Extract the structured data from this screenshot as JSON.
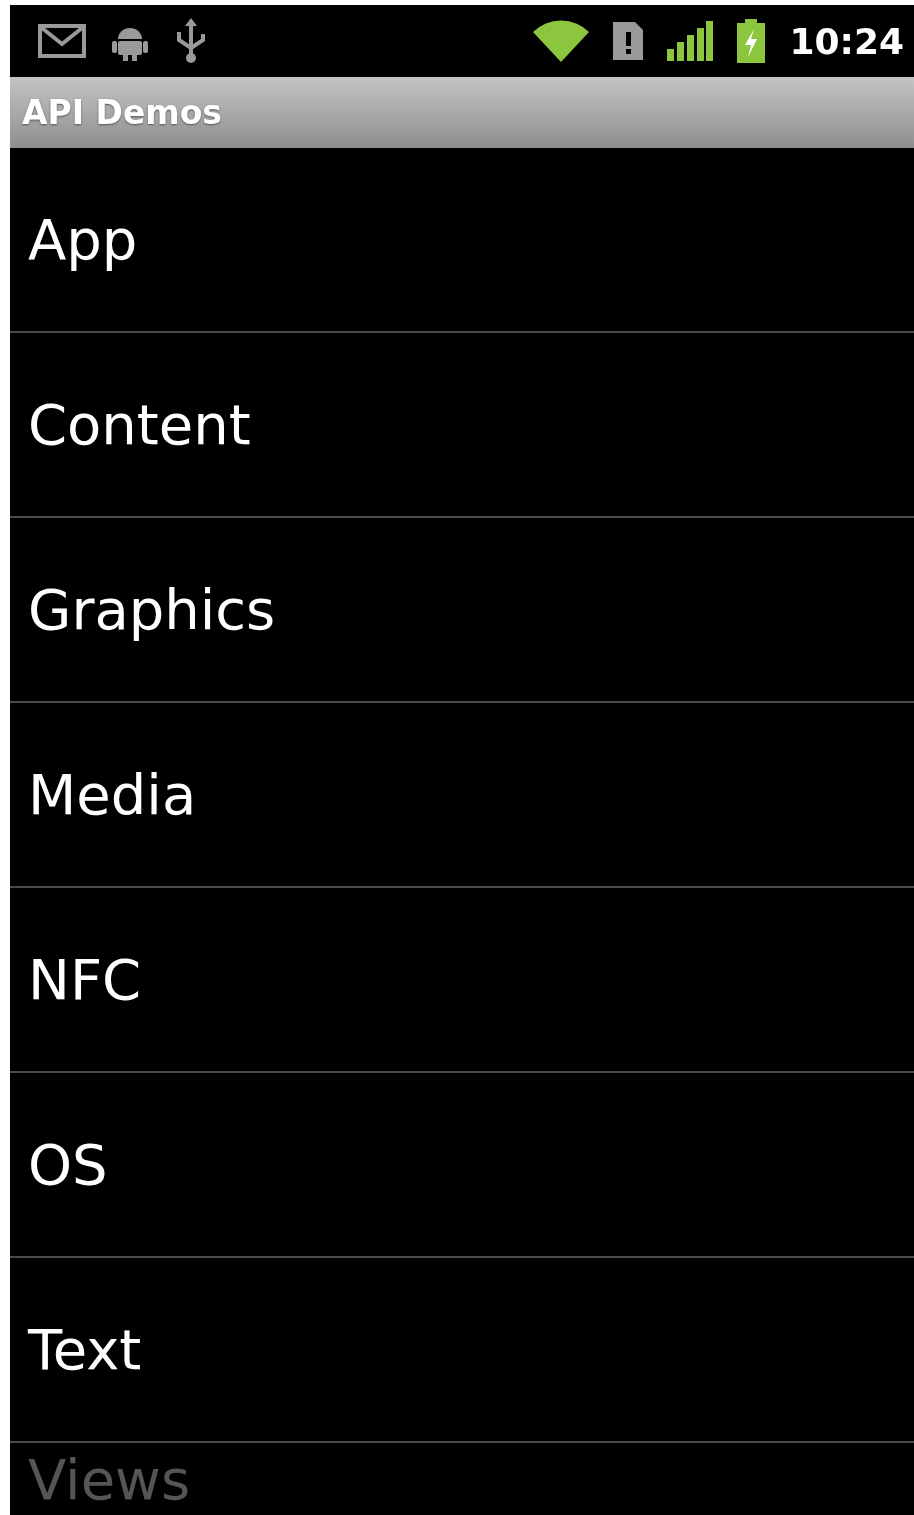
{
  "status_bar": {
    "time": "10:24"
  },
  "title_bar": {
    "title": "API Demos"
  },
  "list": [
    {
      "label": "App",
      "faded": false
    },
    {
      "label": "Content",
      "faded": false
    },
    {
      "label": "Graphics",
      "faded": false
    },
    {
      "label": "Media",
      "faded": false
    },
    {
      "label": "NFC",
      "faded": false
    },
    {
      "label": "OS",
      "faded": false
    },
    {
      "label": "Text",
      "faded": false
    },
    {
      "label": "Views",
      "faded": true
    }
  ]
}
